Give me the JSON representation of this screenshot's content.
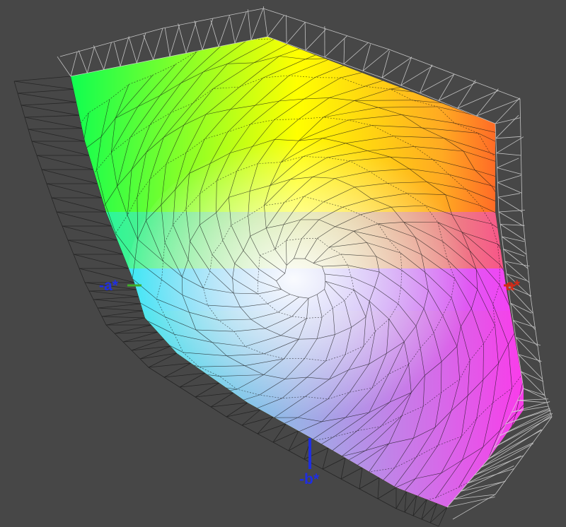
{
  "viewer": {
    "background": "#474747",
    "axes": {
      "neg_a": {
        "label": "-a*",
        "color": "#1f2ee0",
        "marker_color": "#3fae2a"
      },
      "pos_a": {
        "label": "a*",
        "color": "#d42a18",
        "marker_color": "#d42a18"
      },
      "neg_b": {
        "label": "-b*",
        "color": "#1f2ee0",
        "marker_color": "#1f2ee0"
      }
    },
    "gamut_colors": {
      "green": "#00ff55",
      "yellow": "#ffff00",
      "orange": "#ff7a1a",
      "red": "#ff2a3a",
      "magenta": "#ff33ff",
      "violet": "#a58cff",
      "cyan": "#00ffff",
      "white": "#ffffff"
    }
  }
}
